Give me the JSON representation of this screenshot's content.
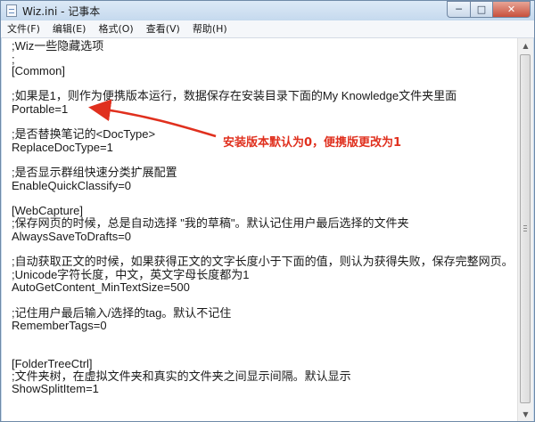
{
  "window": {
    "title": "Wiz.ini - 记事本",
    "min_glyph": "─",
    "max_glyph": "□",
    "close_glyph": "✕"
  },
  "menu": {
    "items": [
      "文件(F)",
      "编辑(E)",
      "格式(O)",
      "查看(V)",
      "帮助(H)"
    ]
  },
  "editor": {
    "lines": [
      ";Wiz一些隐藏选项",
      ";",
      "[Common]",
      "",
      ";如果是1，则作为便携版本运行，数据保存在安装目录下面的My Knowledge文件夹里面",
      "Portable=1",
      "",
      ";是否替换笔记的<DocType>",
      "ReplaceDocType=1",
      "",
      ";是否显示群组快速分类扩展配置",
      "EnableQuickClassify=0",
      "",
      "[WebCapture]",
      ";保存网页的时候，总是自动选择 \"我的草稿\"。默认记住用户最后选择的文件夹",
      "AlwaysSaveToDrafts=0",
      "",
      ";自动获取正文的时候，如果获得正文的文字长度小于下面的值，则认为获得失败，保存完整网页。",
      ";Unicode字符长度，中文，英文字母长度都为1",
      "AutoGetContent_MinTextSize=500",
      "",
      ";记住用户最后输入/选择的tag。默认不记住",
      "RememberTags=0",
      "",
      "",
      "[FolderTreeCtrl]",
      ";文件夹树，在虚拟文件夹和真实的文件夹之间显示间隔。默认显示",
      "ShowSplitItem=1"
    ]
  },
  "annotation": {
    "text": "安装版本默认为0，便携版更改为1",
    "color": "#e0301e"
  },
  "scrollbar": {
    "up_glyph": "▲",
    "down_glyph": "▼"
  }
}
